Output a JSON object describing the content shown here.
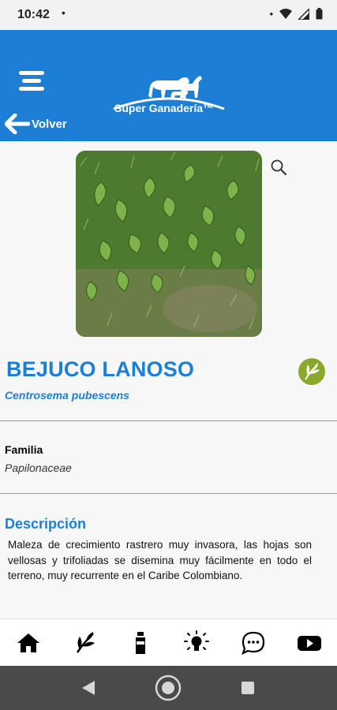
{
  "status": {
    "time": "10:42",
    "dot": "•"
  },
  "header": {
    "brand": "Súper Ganadería™",
    "back_label": "Volver"
  },
  "plant": {
    "name": "BEJUCO LANOSO",
    "scientific_name": "Centrosema pubescens",
    "family_label": "Familia",
    "family_value": "Papilonaceae",
    "description_title": "Descripción",
    "description": "Maleza de crecimiento rastrero muy invasora, las hojas son vellosas y trifoliadas se disemina muy fácilmente en todo el terreno, muy recurrente en el Caribe Colombiano."
  },
  "colors": {
    "primary": "#1d7ed6",
    "badge": "#8aa82c",
    "system_nav": "#4a4a4a"
  },
  "bottom_nav": [
    {
      "icon": "home-icon"
    },
    {
      "icon": "plant-icon"
    },
    {
      "icon": "bottle-icon"
    },
    {
      "icon": "lightbulb-icon"
    },
    {
      "icon": "chat-icon"
    },
    {
      "icon": "youtube-icon"
    }
  ]
}
